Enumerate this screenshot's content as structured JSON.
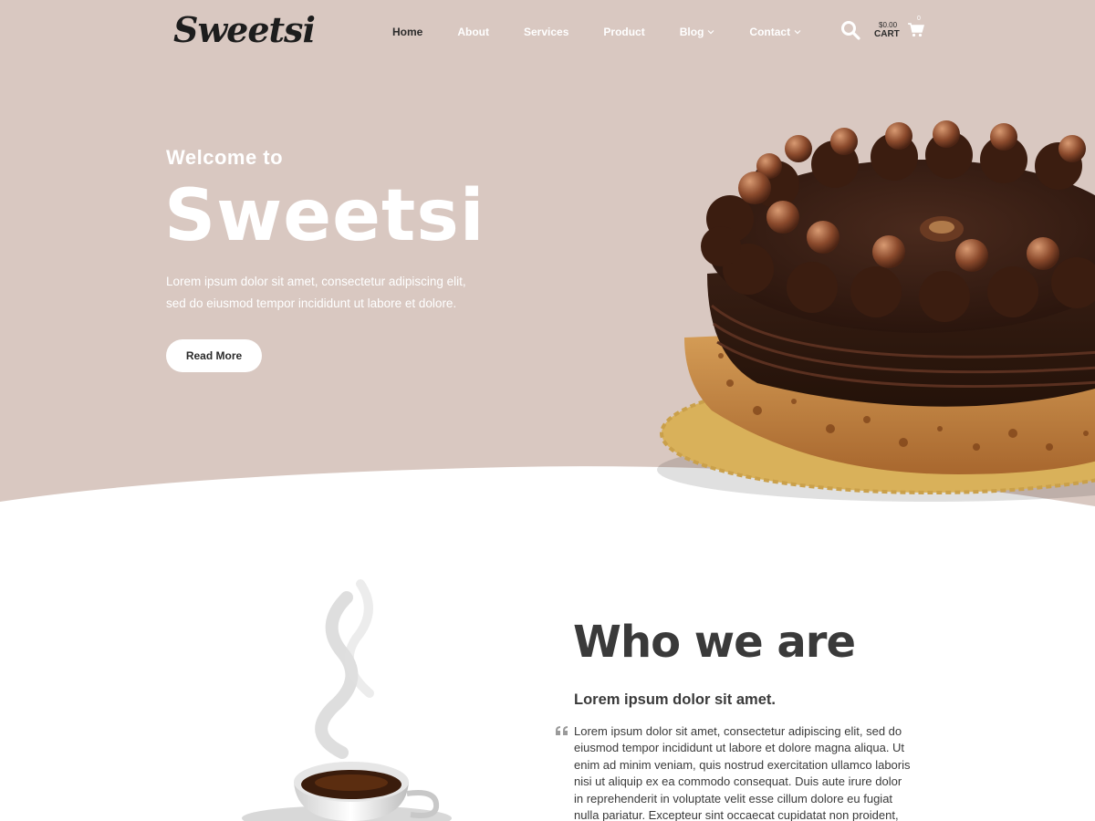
{
  "colors": {
    "hero_bg": "#d9c8c1",
    "accent_dark": "#2b2b2b",
    "text_white": "#ffffff"
  },
  "header": {
    "logo": "Sweetsi",
    "nav": [
      {
        "label": "Home",
        "active": true,
        "dropdown": false
      },
      {
        "label": "About",
        "active": false,
        "dropdown": false
      },
      {
        "label": "Services",
        "active": false,
        "dropdown": false
      },
      {
        "label": "Product",
        "active": false,
        "dropdown": false
      },
      {
        "label": "Blog",
        "active": false,
        "dropdown": true
      },
      {
        "label": "Contact",
        "active": false,
        "dropdown": true
      }
    ],
    "search_icon": "search-icon",
    "cart": {
      "amount": "$0.00",
      "label": "CART",
      "count": "0",
      "icon": "cart-icon"
    }
  },
  "hero": {
    "welcome": "Welcome to",
    "title": "Sweetsi",
    "description": "Lorem ipsum dolor sit amet, consectetur adipiscing elit, sed do eiusmod tempor incididunt ut labore et dolore.",
    "button": "Read More",
    "image": "chocolate-cake-image"
  },
  "about": {
    "title": "Who we are",
    "subtitle": "Lorem ipsum dolor sit amet.",
    "quote_icon": "quote-icon",
    "text": "Lorem ipsum dolor sit amet, consectetur adipiscing elit, sed do eiusmod tempor incididunt ut labore et dolore magna aliqua. Ut enim ad minim veniam, quis nostrud exercitation ullamco laboris nisi ut aliquip ex ea commodo consequat. Duis aute irure dolor in reprehenderit in voluptate velit esse cillum dolore eu fugiat nulla pariatur. Excepteur sint occaecat cupidatat non proident, sunt in",
    "image": "coffee-cup-image"
  }
}
